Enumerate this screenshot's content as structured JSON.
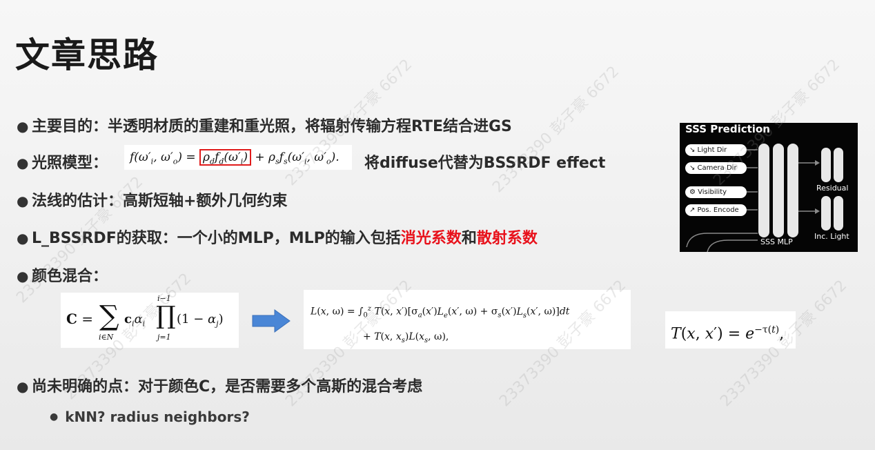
{
  "title": "文章思路",
  "bullets": {
    "b1": "主要目的：半透明材质的重建和重光照，将辐射传输方程RTE结合进GS",
    "b2_label": "光照模型：",
    "b2_text": "将diffuse代替为BSSRDF effect",
    "b3": "法线的估计：高斯短轴+额外几何约束",
    "b4_prefix": "L_BSSRDF的获取：一个小的MLP，MLP的输入包括",
    "b4_red1": "消光系数",
    "b4_mid": "和",
    "b4_red2": "散射系数",
    "b5": "颜色混合：",
    "b6": "尚未明确的点：对于颜色C，是否需要多个高斯的混合考虑",
    "sub1": "kNN? radius neighbors?"
  },
  "diagram": {
    "title": "SSS Prediction",
    "inputs": [
      "↘ Light Dir",
      "↘ Camera Dir",
      "⚙ Visibility",
      "↗ Pos. Encode"
    ],
    "sss_mlp": "SSS MLP",
    "residual": "Residual",
    "inc_light": "Inc. Light"
  },
  "watermark": "23373390 彭子豪 6672",
  "colors": {
    "accent_red": "#e8101a",
    "arrow_blue": "#4a86d6",
    "highlight_box": "#e01b1b"
  }
}
